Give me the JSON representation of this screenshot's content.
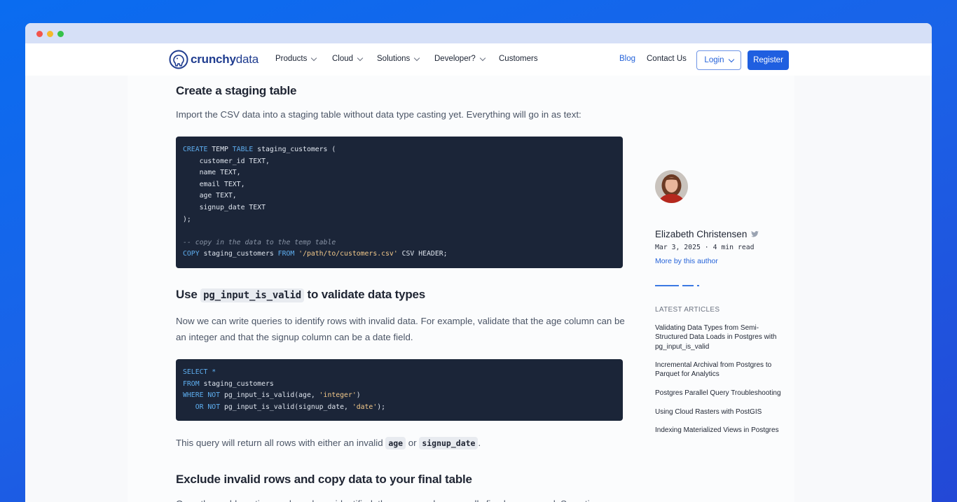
{
  "nav": {
    "logo_bold": "crunchy",
    "logo_light": "data",
    "items": [
      {
        "label": "Products"
      },
      {
        "label": "Cloud"
      },
      {
        "label": "Solutions"
      },
      {
        "label": "Developer?"
      },
      {
        "label": "Customers"
      }
    ],
    "blog": "Blog",
    "contact": "Contact Us",
    "login": "Login",
    "register": "Register"
  },
  "article": {
    "section1_title": "Create a staging table",
    "section1_text": "Import the CSV data into a staging table without data type casting yet. Everything will go in as text:",
    "code1": {
      "l1_kw1": "CREATE",
      "l1_t1": " TEMP ",
      "l1_kw2": "TABLE",
      "l1_t2": " staging_customers (",
      "l2": "    customer_id TEXT,",
      "l3": "    name TEXT,",
      "l4": "    email TEXT,",
      "l5": "    age TEXT,",
      "l6": "    signup_date TEXT",
      "l7": ");",
      "comment": "-- copy in the data to the temp table",
      "l9_kw1": "COPY",
      "l9_t1": " staging_customers ",
      "l9_kw2": "FROM",
      "l9_str": "'/path/to/customers.csv'",
      "l9_t2": " CSV HEADER;"
    },
    "section2_title_pre": "Use ",
    "section2_title_code": "pg_input_is_valid",
    "section2_title_post": " to validate data types",
    "section2_text_l1": "Now we can write queries to identify rows with invalid data. For example, validate that the age column can be",
    "section2_text_l2": "an integer and that the signup column can be a date field.",
    "code2": {
      "l1_kw": "SELECT *",
      "l2_kw": "FROM",
      "l2_t": " staging_customers",
      "l3_kw": "WHERE NOT",
      "l3_t1": " pg_input_is_valid(age, ",
      "l3_str": "'integer'",
      "l3_t2": ")",
      "l4_pad": "   ",
      "l4_kw": "OR NOT",
      "l4_t1": " pg_input_is_valid(signup_date, ",
      "l4_str": "'date'",
      "l4_t2": ");"
    },
    "result_pre": "This query will return all rows with either an invalid ",
    "result_code1": "age",
    "result_mid": " or ",
    "result_code2": "signup_date",
    "result_post": ".",
    "section3_title": "Exclude invalid rows and copy data to your final table",
    "section3_text_partial": "Once the problematic rows have been identified, the rows can be manually fixed or removed. Sometimes an"
  },
  "sidebar": {
    "author_name": "Elizabeth Christensen",
    "meta": "Mar 3, 2025 · 4 min read",
    "more": "More by this author",
    "latest_title": "LATEST ARTICLES",
    "latest": [
      {
        "title": "Validating Data Types from Semi-Structured Data Loads in Postgres with pg_input_is_valid"
      },
      {
        "title": "Incremental Archival from Postgres to Parquet for Analytics"
      },
      {
        "title": "Postgres Parallel Query Troubleshooting"
      },
      {
        "title": "Using Cloud Rasters with PostGIS"
      },
      {
        "title": "Indexing Materialized Views in Postgres"
      }
    ]
  }
}
